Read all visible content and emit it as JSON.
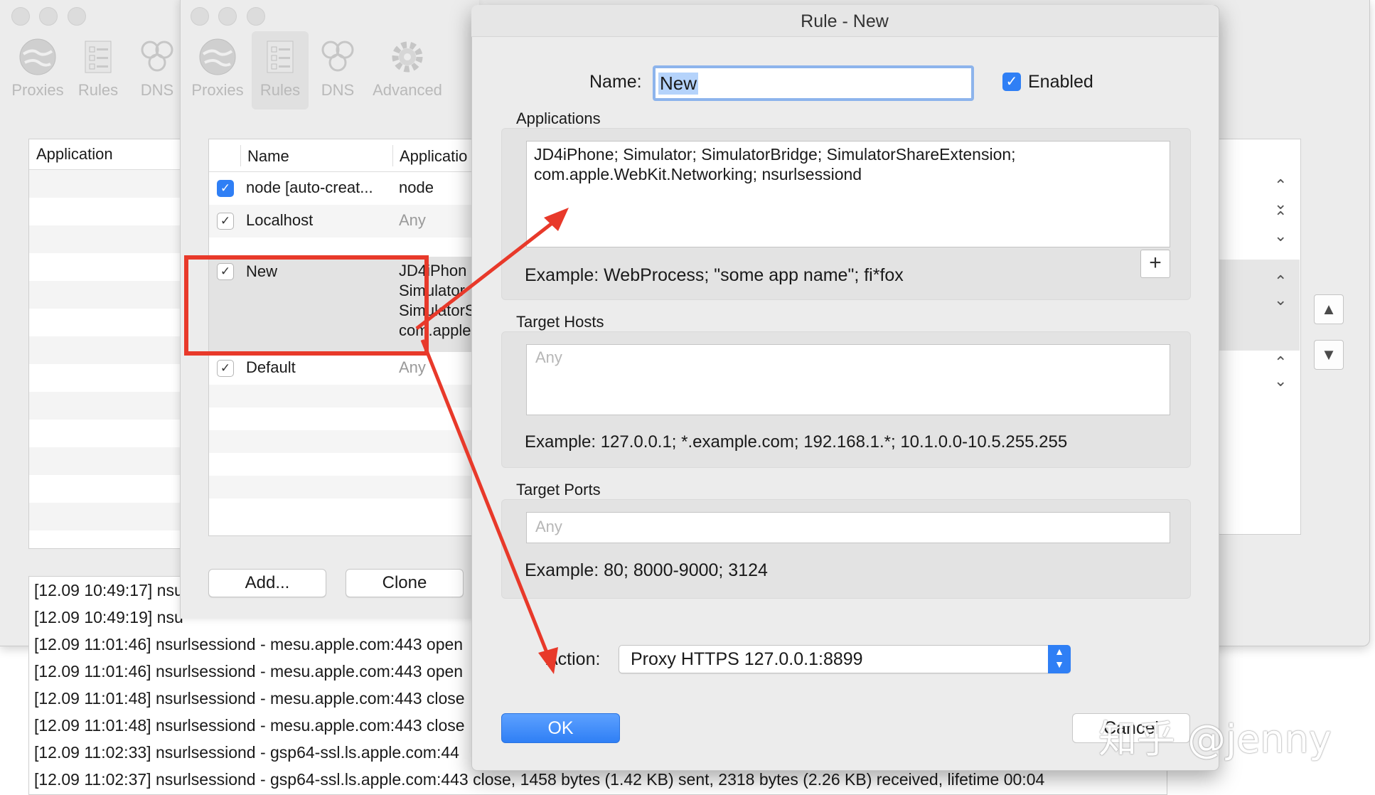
{
  "back_window": {
    "toolbar": [
      {
        "label": "Proxies",
        "icon": "globe-icon"
      },
      {
        "label": "Rules",
        "icon": "rules-list-icon"
      },
      {
        "label": "DNS",
        "icon": "dns-icon"
      }
    ],
    "table_header": "Application",
    "log_lines": [
      "[12.09 10:49:17] nsu",
      "[12.09 10:49:19] nsu",
      "[12.09 11:01:46] nsurlsessiond - mesu.apple.com:443 open",
      "[12.09 11:01:46] nsurlsessiond - mesu.apple.com:443 open",
      "[12.09 11:01:48] nsurlsessiond - mesu.apple.com:443 close",
      "[12.09 11:01:48] nsurlsessiond - mesu.apple.com:443 close",
      "[12.09 11:02:33] nsurlsessiond - gsp64-ssl.ls.apple.com:44",
      "[12.09 11:02:37] nsurlsessiond - gsp64-ssl.ls.apple.com:443 close, 1458 bytes (1.42 KB) sent, 2318 bytes (2.26 KB) received, lifetime 00:04"
    ],
    "move_up": "▲",
    "move_down": "▼"
  },
  "rules_window": {
    "toolbar": [
      {
        "label": "Proxies",
        "icon": "globe-icon"
      },
      {
        "label": "Rules",
        "icon": "rules-list-icon"
      },
      {
        "label": "DNS",
        "icon": "dns-icon"
      },
      {
        "label": "Advanced",
        "icon": "gear-icon"
      }
    ],
    "columns": {
      "name": "Name",
      "application": "Applicatio"
    },
    "rows": [
      {
        "name": "node [auto-creat...",
        "app": "node",
        "checked_style": "blue"
      },
      {
        "name": "Localhost",
        "app": "Any",
        "checked_style": "plain"
      },
      {
        "name": "New",
        "app_lines": [
          "JD4iPhon",
          "Simulator",
          "SimulatorS",
          "com.apple"
        ],
        "checked_style": "plain"
      },
      {
        "name": "Default",
        "app": "Any",
        "checked_style": "plain"
      }
    ],
    "add_button": "Add...",
    "clone_button": "Clone"
  },
  "dialog": {
    "title": "Rule - New",
    "name_label": "Name:",
    "name_value": "New",
    "enabled_label": "Enabled",
    "applications_label": "Applications",
    "applications_value_line1": "JD4iPhone; Simulator; SimulatorBridge; SimulatorShareExtension;",
    "applications_value_line2": "com.apple.WebKit.Networking; nsurlsessiond",
    "applications_add": "+",
    "applications_example": "Example: WebProcess; \"some app name\"; fi*fox",
    "target_hosts_label": "Target Hosts",
    "target_hosts_placeholder": "Any",
    "target_hosts_example": "Example: 127.0.0.1; *.example.com; 192.168.1.*; 10.1.0.0-10.5.255.255",
    "target_ports_label": "Target Ports",
    "target_ports_placeholder": "Any",
    "target_ports_example": "Example: 80; 8000-9000; 3124",
    "action_label": "Action:",
    "action_value": "Proxy HTTPS 127.0.0.1:8899",
    "ok_button": "OK",
    "cancel_button": "Cancel"
  },
  "annotation": {
    "color": "#e8392a"
  },
  "watermark": "知乎 @jenny"
}
